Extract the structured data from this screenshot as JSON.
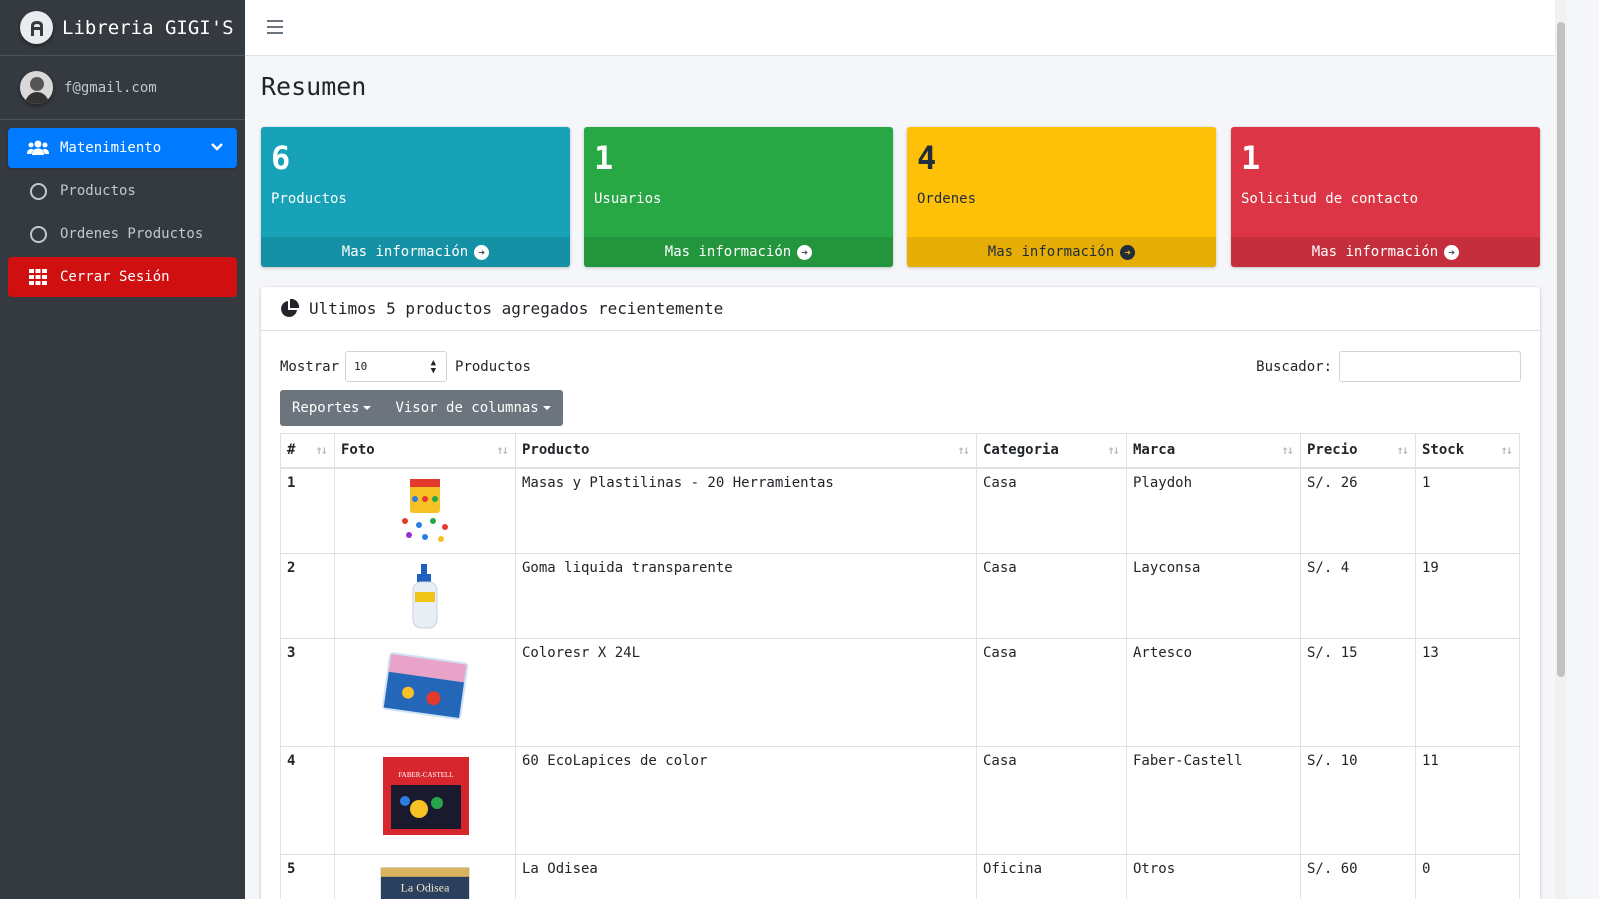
{
  "brand": {
    "name": "Libreria GIGI'S"
  },
  "user": {
    "email": "f@gmail.com"
  },
  "sidebar": {
    "items": [
      {
        "label": "Matenimiento"
      },
      {
        "label": "Productos"
      },
      {
        "label": "Ordenes Productos"
      },
      {
        "label": "Cerrar Sesión"
      }
    ]
  },
  "page": {
    "title": "Resumen"
  },
  "stats": [
    {
      "value": "6",
      "label": "Productos",
      "link": "Mas información",
      "color": "#17a2b8"
    },
    {
      "value": "1",
      "label": "Usuarios",
      "link": "Mas información",
      "color": "#28a745"
    },
    {
      "value": "4",
      "label": "Ordenes",
      "link": "Mas información",
      "color": "#ffc107"
    },
    {
      "value": "1",
      "label": "Solicitud de contacto",
      "link": "Mas información",
      "color": "#dc3545"
    }
  ],
  "card": {
    "title": "Ultimos 5 productos agregados recientemente",
    "show_label": "Mostrar",
    "page_size": "10",
    "show_suffix": "Productos",
    "search_label": "Buscador:",
    "buttons": {
      "reports": "Reportes",
      "columns": "Visor de columnas"
    }
  },
  "table": {
    "headers": [
      "#",
      "Foto",
      "Producto",
      "Categoria",
      "Marca",
      "Precio",
      "Stock"
    ],
    "rows": [
      {
        "id": "1",
        "product": "Masas y Plastilinas - 20 Herramientas",
        "category": "Casa",
        "brand": "Playdoh",
        "price": "S/. 26",
        "stock": "1"
      },
      {
        "id": "2",
        "product": "Goma liquida transparente",
        "category": "Casa",
        "brand": "Layconsa",
        "price": "S/. 4",
        "stock": "19"
      },
      {
        "id": "3",
        "product": "Coloresr X 24L",
        "category": "Casa",
        "brand": "Artesco",
        "price": "S/. 15",
        "stock": "13"
      },
      {
        "id": "4",
        "product": "60 EcoLapices de color",
        "category": "Casa",
        "brand": "Faber-Castell",
        "price": "S/. 10",
        "stock": "11"
      },
      {
        "id": "5",
        "product": "La Odisea",
        "category": "Oficina",
        "brand": "Otros",
        "price": "S/. 60",
        "stock": "0"
      }
    ],
    "thumb_texts": {
      "faber": "FABER-CASTELL",
      "odisea": "La Odisea"
    }
  }
}
